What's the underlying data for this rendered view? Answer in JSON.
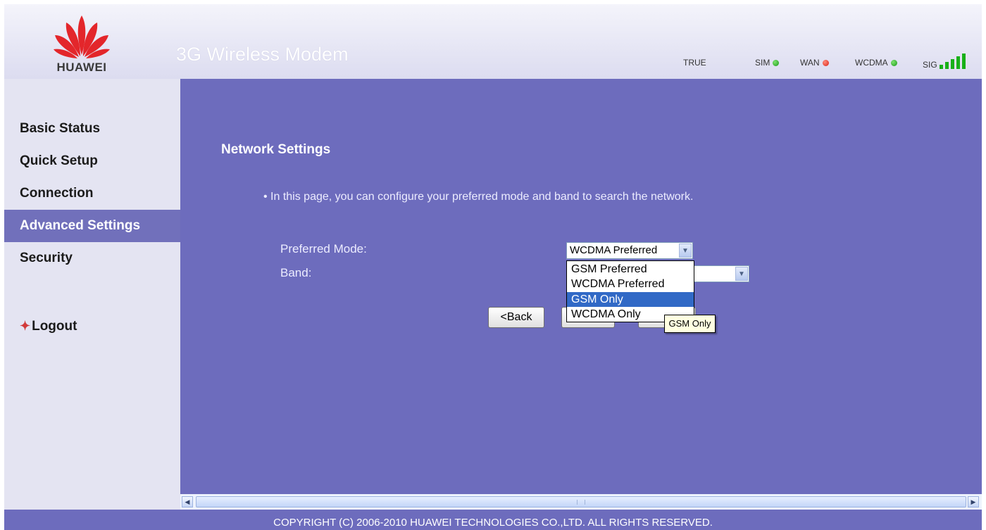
{
  "header": {
    "logo_text": "HUAWEI",
    "title": "3G Wireless Modem",
    "status": {
      "operator": "TRUE",
      "sim_label": "SIM",
      "sim_color": "#22aa22",
      "wan_label": "WAN",
      "wan_color": "#dd2a1a",
      "network_label": "WCDMA",
      "network_color": "#22aa22",
      "signal_label": "SIG",
      "signal_level": 5,
      "signal_max": 5,
      "signal_color": "#18b018"
    }
  },
  "sidebar": {
    "items": [
      {
        "label": "Basic Status"
      },
      {
        "label": "Quick Setup"
      },
      {
        "label": "Connection"
      },
      {
        "label": "Advanced Settings",
        "active": true
      },
      {
        "label": "Security"
      }
    ],
    "logout_label": "Logout",
    "active_bg": "#7170bb"
  },
  "main": {
    "title": "Network Settings",
    "description": "In this page, you can configure your preferred mode and band to search the network.",
    "preferred_mode_label": "Preferred Mode:",
    "preferred_mode_value": "WCDMA Preferred",
    "band_label": "Band:",
    "band_value": "",
    "back_button": "<Back",
    "dropdown_options": [
      "GSM Preferred",
      "WCDMA Preferred",
      "GSM Only",
      "WCDMA Only"
    ],
    "dropdown_highlighted": "GSM Only",
    "tooltip": "GSM Only",
    "bg_color": "#6d6cbd"
  },
  "footer": {
    "copyright": "COPYRIGHT (C) 2006-2010 HUAWEI TECHNOLOGIES CO.,LTD. ALL RIGHTS RESERVED."
  }
}
